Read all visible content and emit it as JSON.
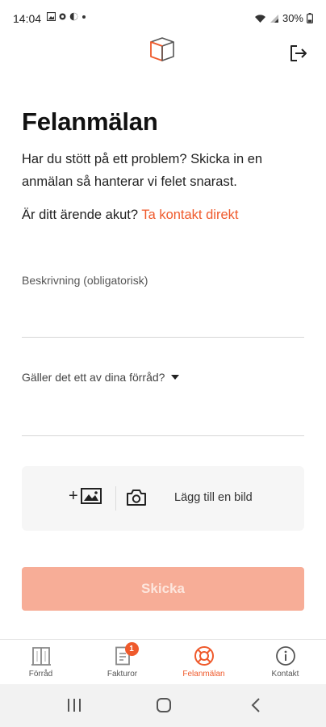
{
  "status_bar": {
    "time": "14:04",
    "battery": "30%"
  },
  "header": {
    "logo_icon": "box-logo-icon",
    "logout_icon": "logout-icon"
  },
  "page": {
    "title": "Felanmälan",
    "intro": "Har du stött på ett problem? Skicka in en anmälan så hanterar vi felet snarast.",
    "urgent_prefix": "Är ditt ärende akut?",
    "urgent_link": "Ta kontakt direkt"
  },
  "form": {
    "description_label": "Beskrivning (obligatorisk)",
    "storage_label": "Gäller det ett av dina förråd?",
    "add_image_label": "Lägg till en bild",
    "submit_label": "Skicka"
  },
  "bottom_nav": {
    "items": [
      {
        "label": "Förråd",
        "icon": "storage-door-icon",
        "active": false
      },
      {
        "label": "Fakturor",
        "icon": "invoice-icon",
        "active": false,
        "badge": "1"
      },
      {
        "label": "Felanmälan",
        "icon": "lifebuoy-icon",
        "active": true
      },
      {
        "label": "Kontakt",
        "icon": "info-icon",
        "active": false
      }
    ]
  },
  "colors": {
    "accent": "#ef5a2c",
    "button_disabled": "#f7ad97",
    "button_text": "#fde6dd"
  }
}
